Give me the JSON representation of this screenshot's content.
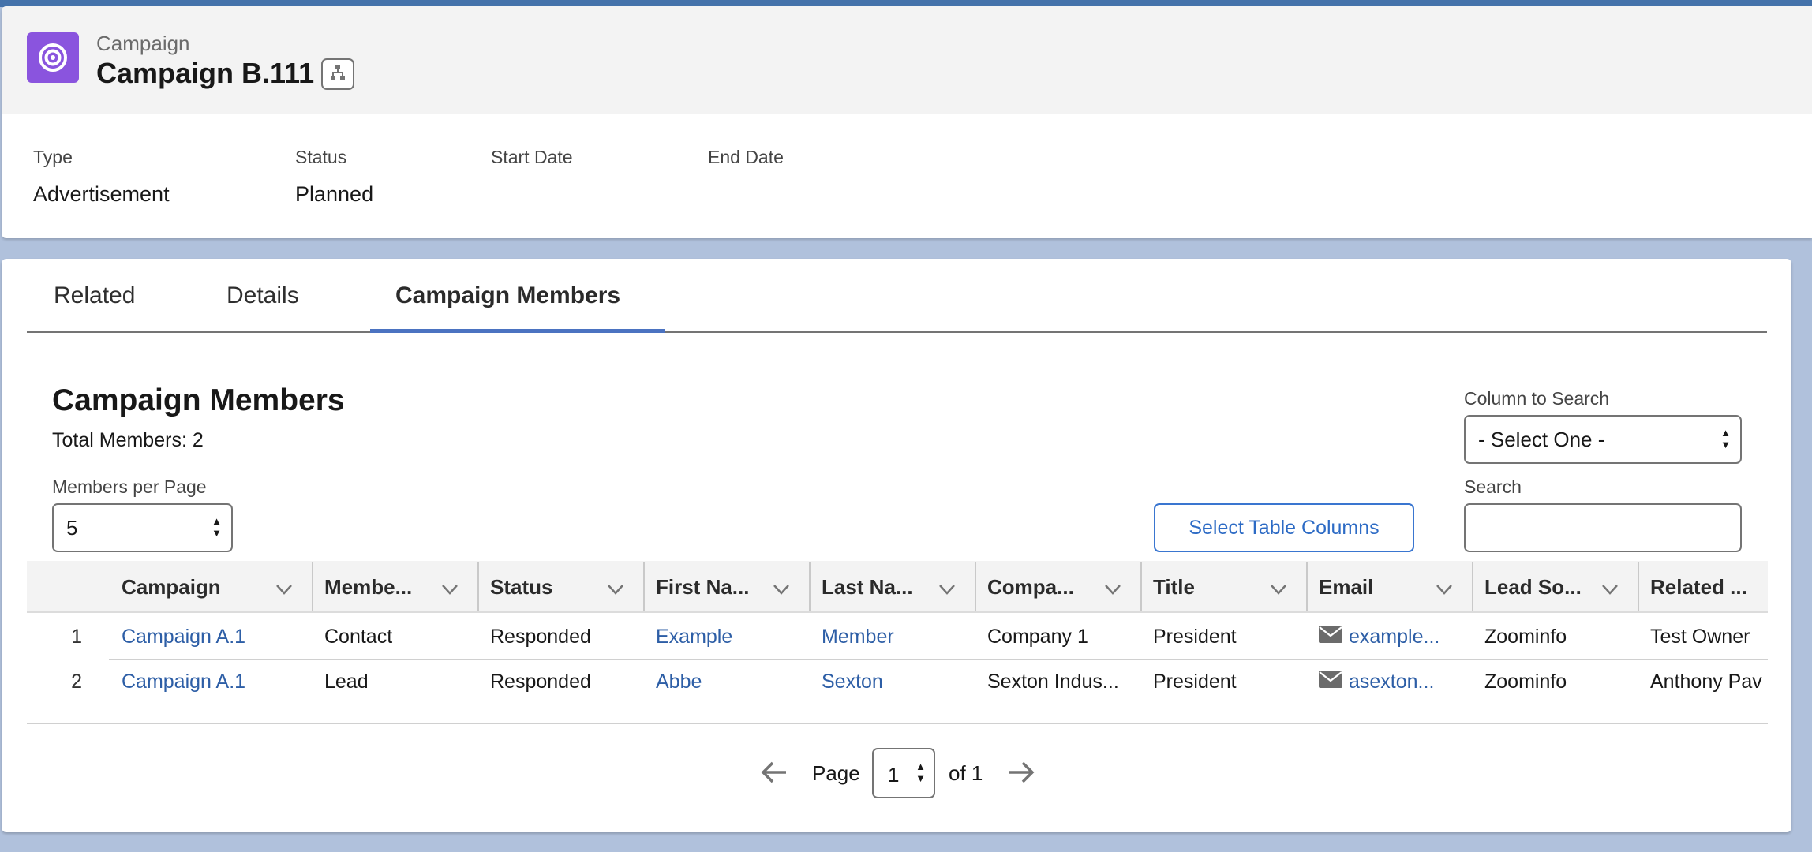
{
  "header": {
    "entity_label": "Campaign",
    "record_title": "Campaign B.111",
    "icon": "campaign-target-icon",
    "hierarchy_icon": "hierarchy-icon",
    "icon_color": "#8a54de"
  },
  "fields": [
    {
      "label": "Type",
      "value": "Advertisement"
    },
    {
      "label": "Status",
      "value": "Planned"
    },
    {
      "label": "Start Date",
      "value": ""
    },
    {
      "label": "End Date",
      "value": ""
    }
  ],
  "tabs": [
    {
      "label": "Related",
      "active": false
    },
    {
      "label": "Details",
      "active": false
    },
    {
      "label": "Campaign Members",
      "active": true
    }
  ],
  "members_section": {
    "title": "Campaign Members",
    "total_label": "Total Members: 2",
    "per_page_label": "Members per Page",
    "per_page_value": "5",
    "column_search_label": "Column to Search",
    "column_search_value": "- Select One -",
    "search_label": "Search",
    "search_value": "",
    "select_columns_button": "Select Table Columns"
  },
  "table": {
    "columns": [
      "Campaign",
      "Membe...",
      "Status",
      "First Na...",
      "Last Na...",
      "Compa...",
      "Title",
      "Email",
      "Lead So...",
      "Related ..."
    ],
    "rows": [
      {
        "num": "1",
        "campaign": "Campaign A.1",
        "member_type": "Contact",
        "status": "Responded",
        "first_name": "Example",
        "last_name": "Member",
        "company": "Company 1",
        "title": "President",
        "email": "example...",
        "lead_source": "Zoominfo",
        "related": "Test Owner"
      },
      {
        "num": "2",
        "campaign": "Campaign A.1",
        "member_type": "Lead",
        "status": "Responded",
        "first_name": "Abbe",
        "last_name": "Sexton",
        "company": "Sexton Indus...",
        "title": "President",
        "email": "asexton...",
        "lead_source": "Zoominfo",
        "related": "Anthony Pav"
      }
    ]
  },
  "pagination": {
    "page_label": "Page",
    "current_page": "1",
    "of_label": "of 1",
    "prev_icon": "arrow-left-icon",
    "next_icon": "arrow-right-icon"
  },
  "colors": {
    "accent": "#4b73c1",
    "link": "#2d5ea6",
    "background": "#b0c1dc",
    "top_strip": "#4472aa"
  }
}
